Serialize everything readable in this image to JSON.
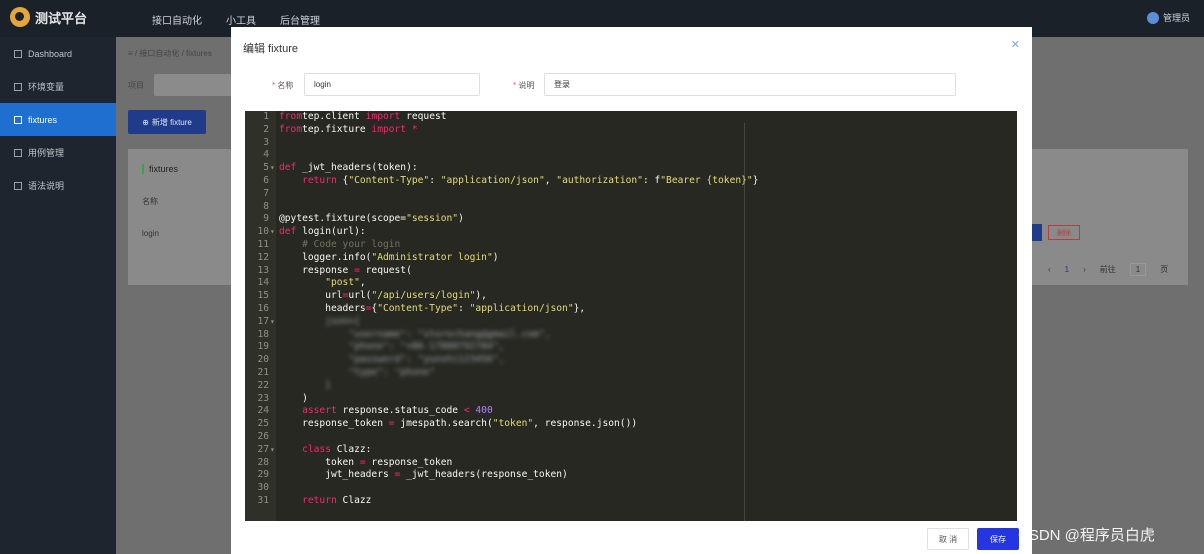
{
  "app": {
    "title": "测试平台",
    "user": "管理员"
  },
  "topnav": [
    "接口自动化",
    "小工具",
    "后台管理"
  ],
  "sidebar": [
    {
      "label": "Dashboard",
      "icon": "bar-chart-icon",
      "active": false
    },
    {
      "label": "环境变量",
      "icon": "document-icon",
      "active": false
    },
    {
      "label": "fixtures",
      "icon": "gear-icon",
      "active": true
    },
    {
      "label": "用例管理",
      "icon": "edit-icon",
      "active": false
    },
    {
      "label": "语法说明",
      "icon": "location-icon",
      "active": false
    }
  ],
  "main": {
    "breadcrumb": [
      "接口自动化",
      "fixtures"
    ],
    "project_label": "项目",
    "add_button": "新增 fixture",
    "panel_title": "fixtures",
    "table_header": "名称",
    "row_name": "login",
    "delete_label": "删除",
    "pager": {
      "current": "1",
      "goto_label": "前往",
      "page_input": "1",
      "page_unit": "页"
    }
  },
  "dialog": {
    "title": "编辑 fixture",
    "name_label": "名称",
    "name_value": "login",
    "desc_label": "说明",
    "desc_value": "登录",
    "cancel_label": "取 消",
    "save_label": "保存",
    "code": [
      {
        "n": "1",
        "fold": false,
        "t": [
          [
            "kw",
            "from"
          ],
          [
            "",
            "tep.client "
          ],
          [
            "kw",
            "import"
          ],
          [
            "",
            " request"
          ]
        ]
      },
      {
        "n": "2",
        "fold": false,
        "t": [
          [
            "kw",
            "from"
          ],
          [
            "",
            "tep.fixture "
          ],
          [
            "kw",
            "import"
          ],
          [
            "kw",
            " *"
          ]
        ]
      },
      {
        "n": "3",
        "fold": false,
        "t": []
      },
      {
        "n": "4",
        "fold": false,
        "t": []
      },
      {
        "n": "5",
        "fold": true,
        "t": [
          [
            "kw",
            "def"
          ],
          [
            "",
            " _jwt_headers(token):"
          ]
        ]
      },
      {
        "n": "6",
        "fold": false,
        "t": [
          [
            "",
            "    "
          ],
          [
            "kw",
            "return"
          ],
          [
            "",
            " {"
          ],
          [
            "str",
            "\"Content-Type\""
          ],
          [
            "",
            ": "
          ],
          [
            "str",
            "\"application/json\""
          ],
          [
            "",
            ", "
          ],
          [
            "str",
            "\"authorization\""
          ],
          [
            "",
            ": f"
          ],
          [
            "str",
            "\"Bearer {token}\""
          ],
          [
            "",
            "}"
          ]
        ]
      },
      {
        "n": "7",
        "fold": false,
        "t": []
      },
      {
        "n": "8",
        "fold": false,
        "t": []
      },
      {
        "n": "9",
        "fold": false,
        "t": [
          [
            "",
            "@pytest.fixture(scope="
          ],
          [
            "str",
            "\"session\""
          ],
          [
            "",
            ")"
          ]
        ]
      },
      {
        "n": "10",
        "fold": true,
        "t": [
          [
            "kw",
            "def"
          ],
          [
            "",
            " login(url):"
          ]
        ]
      },
      {
        "n": "11",
        "fold": false,
        "t": [
          [
            "",
            "    "
          ],
          [
            "cm",
            "# Code your login"
          ]
        ]
      },
      {
        "n": "12",
        "fold": false,
        "t": [
          [
            "",
            "    logger.info("
          ],
          [
            "str",
            "\"Administrator login\""
          ],
          [
            "",
            ")"
          ]
        ]
      },
      {
        "n": "13",
        "fold": false,
        "t": [
          [
            "",
            "    response "
          ],
          [
            "kw",
            "="
          ],
          [
            "",
            " request("
          ]
        ]
      },
      {
        "n": "14",
        "fold": false,
        "t": [
          [
            "",
            "        "
          ],
          [
            "str",
            "\"post\""
          ],
          [
            "",
            ","
          ]
        ]
      },
      {
        "n": "15",
        "fold": false,
        "t": [
          [
            "",
            "        url"
          ],
          [
            "kw",
            "="
          ],
          [
            "",
            "url("
          ],
          [
            "str",
            "\"/api/users/login\""
          ],
          [
            "",
            "),"
          ]
        ]
      },
      {
        "n": "16",
        "fold": false,
        "t": [
          [
            "",
            "        headers"
          ],
          [
            "kw",
            "="
          ],
          [
            "",
            "{"
          ],
          [
            "str",
            "\"Content-Type\""
          ],
          [
            "",
            ": "
          ],
          [
            "str",
            "\"application/json\""
          ],
          [
            "",
            "},"
          ]
        ]
      },
      {
        "n": "17",
        "fold": true,
        "t": [
          [
            "",
            "        "
          ],
          [
            "blur",
            "json={"
          ]
        ]
      },
      {
        "n": "18",
        "fold": false,
        "t": [
          [
            "",
            "            "
          ],
          [
            "blur",
            "\"username\": \"storechang@gmail.com\","
          ]
        ]
      },
      {
        "n": "19",
        "fold": false,
        "t": [
          [
            "",
            "            "
          ],
          [
            "blur",
            "\"phone\": \"+86-17800792784\","
          ]
        ]
      },
      {
        "n": "20",
        "fold": false,
        "t": [
          [
            "",
            "            "
          ],
          [
            "blur",
            "\"password\": \"yunshi123456\","
          ]
        ]
      },
      {
        "n": "21",
        "fold": false,
        "t": [
          [
            "",
            "            "
          ],
          [
            "blur",
            "\"type\": \"phone\""
          ]
        ]
      },
      {
        "n": "22",
        "fold": false,
        "t": [
          [
            "",
            "        "
          ],
          [
            "blur",
            "}"
          ]
        ]
      },
      {
        "n": "23",
        "fold": false,
        "t": [
          [
            "",
            "    )"
          ]
        ]
      },
      {
        "n": "24",
        "fold": false,
        "t": [
          [
            "",
            "    "
          ],
          [
            "kw",
            "assert"
          ],
          [
            "",
            " response.status_code "
          ],
          [
            "kw",
            "<"
          ],
          [
            "",
            " "
          ],
          [
            "num",
            "400"
          ]
        ]
      },
      {
        "n": "25",
        "fold": false,
        "t": [
          [
            "",
            "    response_token "
          ],
          [
            "kw",
            "="
          ],
          [
            "",
            " jmespath.search("
          ],
          [
            "str",
            "\"token\""
          ],
          [
            "",
            ", response.json())"
          ]
        ]
      },
      {
        "n": "26",
        "fold": false,
        "t": []
      },
      {
        "n": "27",
        "fold": true,
        "t": [
          [
            "",
            "    "
          ],
          [
            "kw",
            "class"
          ],
          [
            "",
            " Clazz:"
          ]
        ]
      },
      {
        "n": "28",
        "fold": false,
        "t": [
          [
            "",
            "        token "
          ],
          [
            "kw",
            "="
          ],
          [
            "",
            " response_token"
          ]
        ]
      },
      {
        "n": "29",
        "fold": false,
        "t": [
          [
            "",
            "        jwt_headers "
          ],
          [
            "kw",
            "="
          ],
          [
            "",
            " _jwt_headers(response_token)"
          ]
        ]
      },
      {
        "n": "30",
        "fold": false,
        "t": []
      },
      {
        "n": "31",
        "fold": false,
        "t": [
          [
            "",
            "    "
          ],
          [
            "kw",
            "return"
          ],
          [
            "",
            " Clazz"
          ]
        ]
      }
    ]
  },
  "watermark": "CSDN @程序员白虎",
  "colors": {
    "accent": "#1f6fd0",
    "save": "#2536e0",
    "editor_bg": "#272822"
  }
}
